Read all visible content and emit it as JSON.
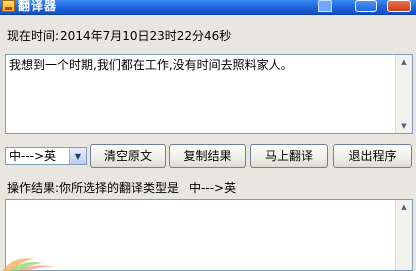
{
  "window": {
    "title": "翻译器",
    "title_icon": "app-icon"
  },
  "time": {
    "label": "现在时间:",
    "value": "2014年7月10日23时22分46秒"
  },
  "input": {
    "text": "我想到一个时期,我们都在工作,没有时间去照料家人。"
  },
  "direction": {
    "selected": "中--->英"
  },
  "buttons": {
    "clear": "清空原文",
    "copy": "复制结果",
    "translate": "马上翻译",
    "exit": "退出程序"
  },
  "result": {
    "label": "操作结果:你所选择的翻译类型是",
    "type": "中--->英",
    "text": ""
  },
  "colors": {
    "title_bar": "#1a5fd8",
    "window_bg": "#e9e6df",
    "textbox_border": "#7f9db9"
  }
}
